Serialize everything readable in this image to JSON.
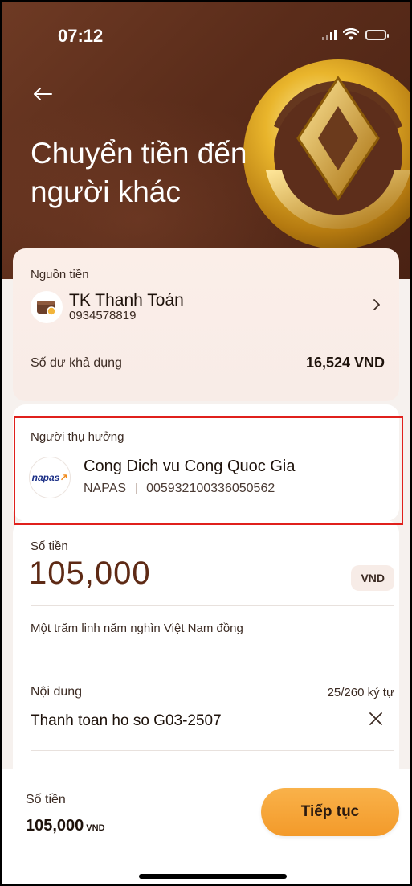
{
  "status": {
    "time": "07:12"
  },
  "header": {
    "title": "Chuyển tiền đến người khác"
  },
  "source": {
    "label": "Nguồn tiền",
    "account_name": "TK Thanh Toán",
    "account_number": "0934578819",
    "balance_label": "Số dư khả dụng",
    "balance_value": "16,524 VND"
  },
  "beneficiary": {
    "label": "Người thụ hưởng",
    "name": "Cong Dich vu Cong Quoc Gia",
    "bank": "NAPAS",
    "account": "005932100336050562",
    "logo_text": "napas"
  },
  "amount": {
    "label": "Số tiền",
    "value": "105,000",
    "currency": "VND",
    "in_words": "Một trăm linh năm nghìn Việt Nam đồng"
  },
  "note": {
    "label": "Nội dung",
    "counter": "25/260 ký tự",
    "value": "Thanh toan ho so G03-2507"
  },
  "footer": {
    "amount_label": "Số tiền",
    "amount_value": "105,000",
    "amount_currency": "VND",
    "continue_label": "Tiếp tục"
  },
  "colors": {
    "hero": "#5a2c1a",
    "accent": "#f39a2a",
    "amount": "#5e2a15",
    "highlight": "#e0201c"
  }
}
